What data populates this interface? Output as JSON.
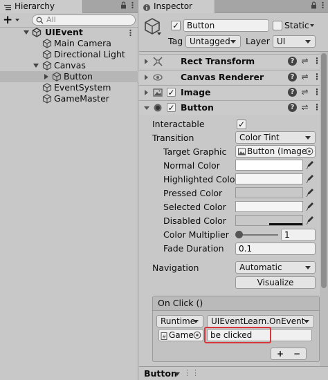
{
  "hierarchy": {
    "tab_label": "Hierarchy",
    "search_placeholder": "All",
    "add_label": "+",
    "items": [
      {
        "label": "UIEvent",
        "depth": 0,
        "expanded": true,
        "is_scene": true
      },
      {
        "label": "Main Camera",
        "depth": 1
      },
      {
        "label": "Directional Light",
        "depth": 1
      },
      {
        "label": "Canvas",
        "depth": 1,
        "expanded": true
      },
      {
        "label": "Button",
        "depth": 2,
        "collapsed": true,
        "selected": true
      },
      {
        "label": "EventSystem",
        "depth": 1
      },
      {
        "label": "GameMaster",
        "depth": 1
      }
    ]
  },
  "inspector": {
    "tab_label": "Inspector",
    "object": {
      "active": true,
      "name": "Button",
      "static_label": "Static",
      "tag_label": "Tag",
      "tag_value": "Untagged",
      "layer_label": "Layer",
      "layer_value": "UI"
    },
    "components": [
      {
        "name": "Rect Transform",
        "has_toggle": false,
        "icon": "rect-transform-icon"
      },
      {
        "name": "Canvas Renderer",
        "has_toggle": false,
        "icon": "canvas-renderer-icon"
      },
      {
        "name": "Image",
        "has_toggle": true,
        "icon": "image-icon"
      },
      {
        "name": "Button",
        "has_toggle": true,
        "icon": "button-component-icon"
      }
    ],
    "button_props": {
      "interactable_label": "Interactable",
      "transition_label": "Transition",
      "transition_value": "Color Tint",
      "target_graphic_label": "Target Graphic",
      "target_graphic_value": "Button (Image",
      "normal_color_label": "Normal Color",
      "highlighted_color_label": "Highlighted Color",
      "pressed_color_label": "Pressed Color",
      "selected_color_label": "Selected Color",
      "disabled_color_label": "Disabled Color",
      "color_multiplier_label": "Color Multiplier",
      "color_multiplier_value": "1",
      "fade_duration_label": "Fade Duration",
      "fade_duration_value": "0.1",
      "navigation_label": "Navigation",
      "navigation_value": "Automatic",
      "visualize_label": "Visualize"
    },
    "on_click": {
      "header": "On Click ()",
      "runtime_value": "Runtime",
      "function_value": "UIEventLearn.OnEvent",
      "object_value": "Game",
      "argument_value": "be clicked",
      "add_label": "+",
      "remove_label": "−"
    },
    "footer_label": "Button"
  },
  "colors": {
    "panel_bg": "#c8c8c8",
    "selection": "#b6b6b6",
    "highlight_border": "#d9363e",
    "disabled_bar": "#111111"
  }
}
